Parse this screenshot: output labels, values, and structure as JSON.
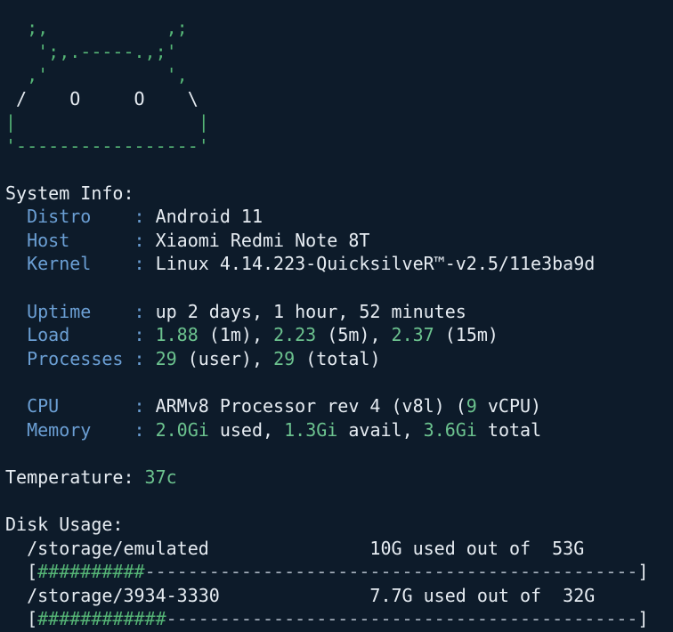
{
  "logo_art": {
    "l1a": "  ;,           ,;",
    "l2a": "   ';,.-----.,;'",
    "l3a": "  ,'           ',",
    "l4a": " /    O     O    \\",
    "l5a": "|                 |",
    "l6a": "'-----------------'"
  },
  "system_info": {
    "heading": "System Info:",
    "distro": {
      "label": "Distro",
      "value": "Android 11"
    },
    "host": {
      "label": "Host",
      "value": "Xiaomi Redmi Note 8T"
    },
    "kernel": {
      "label": "Kernel",
      "value": "Linux 4.14.223-QuicksilveR™-v2.5/11e3ba9d"
    },
    "uptime": {
      "label": "Uptime",
      "value": "up 2 days, 1 hour, 52 minutes"
    },
    "load": {
      "label": "Load",
      "v1": "1.88",
      "u1": " (1m), ",
      "v5": "2.23",
      "u5": " (5m), ",
      "v15": "2.37",
      "u15": " (15m)"
    },
    "processes": {
      "label": "Processes",
      "user": "29",
      "user_text": " (user), ",
      "total": "29",
      "total_text": " (total)"
    },
    "cpu": {
      "label": "CPU",
      "pre": "ARMv8 Processor rev 4 (v8l) (",
      "count": "9",
      "post": " vCPU)"
    },
    "memory": {
      "label": "Memory",
      "used": "2.0Gi",
      "used_text": " used, ",
      "avail": "1.3Gi",
      "avail_text": " avail, ",
      "total": "3.6Gi",
      "total_text": " total"
    }
  },
  "temperature": {
    "label": "Temperature: ",
    "value": "37c"
  },
  "disk_usage": {
    "heading": "Disk Usage:",
    "disks": [
      {
        "path": "/storage/emulated",
        "usage": "10G used out of  53G",
        "fill_fraction": 0.19,
        "bar_open": "[",
        "bar_hash": "##########",
        "bar_dash": "----------------------------------------------",
        "bar_close": "]"
      },
      {
        "path": "/storage/3934-3330",
        "usage": "7.7G used out of  32G",
        "fill_fraction": 0.24,
        "bar_open": "[",
        "bar_hash": "############",
        "bar_dash": "--------------------------------------------",
        "bar_close": "]"
      }
    ]
  },
  "colors": {
    "background": "#0d1b2a",
    "text": "#e6ecf2",
    "label": "#6b9fd4",
    "accent_green": "#55b576"
  }
}
